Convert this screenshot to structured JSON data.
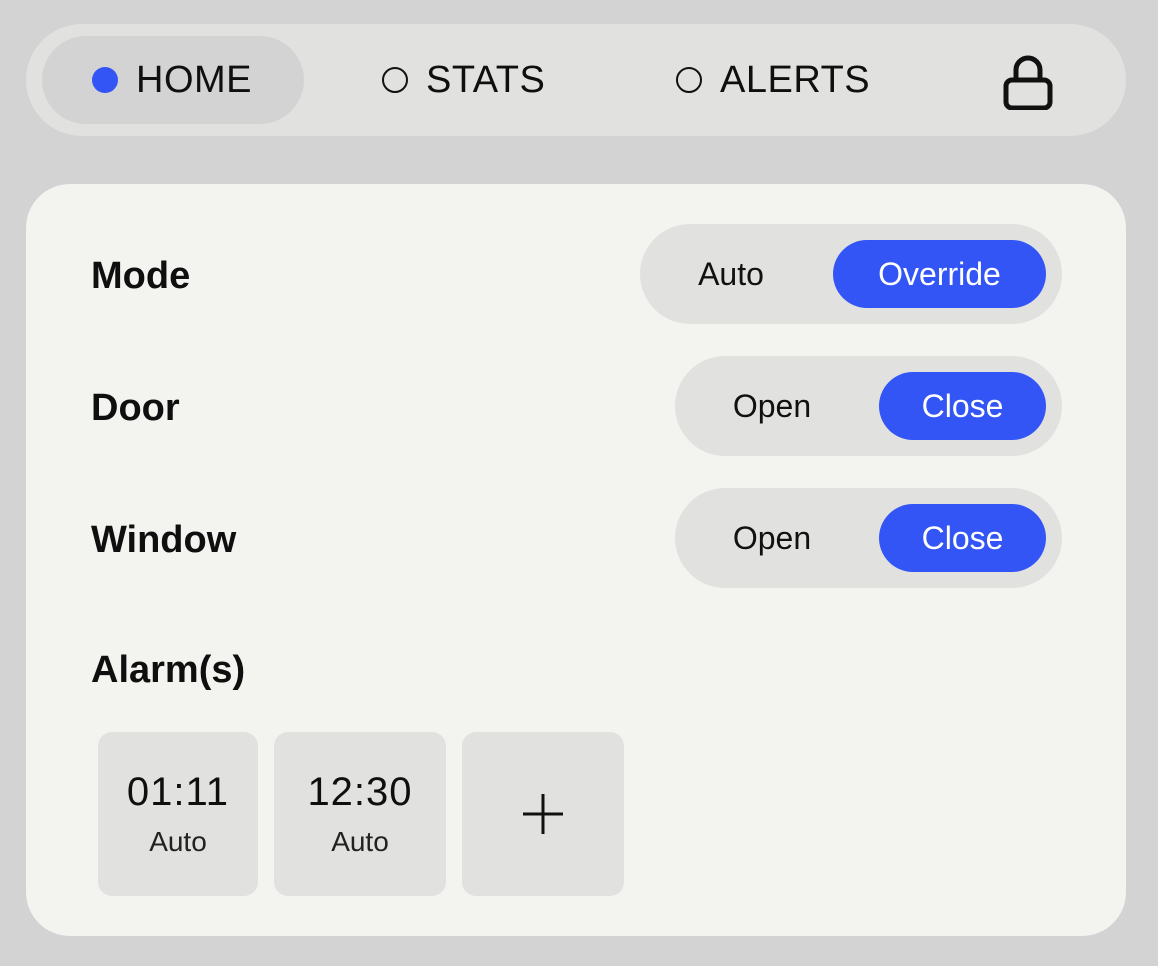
{
  "nav": {
    "tabs": [
      {
        "label": "HOME",
        "active": true
      },
      {
        "label": "STATS",
        "active": false
      },
      {
        "label": "ALERTS",
        "active": false
      }
    ],
    "lock_icon": "lock-icon"
  },
  "controls": {
    "mode": {
      "label": "Mode",
      "options": [
        "Auto",
        "Override"
      ],
      "selected": "Override"
    },
    "door": {
      "label": "Door",
      "options": [
        "Open",
        "Close"
      ],
      "selected": "Close"
    },
    "window": {
      "label": "Window",
      "options": [
        "Open",
        "Close"
      ],
      "selected": "Close"
    }
  },
  "alarms": {
    "label": "Alarm(s)",
    "items": [
      {
        "time": "01:11",
        "mode": "Auto"
      },
      {
        "time": "12:30",
        "mode": "Auto"
      }
    ],
    "add_icon": "plus-icon"
  },
  "colors": {
    "accent": "#3355f5",
    "background": "#d3d3d3",
    "panel": "#f3f4f0",
    "control_bg": "#e1e1df"
  }
}
